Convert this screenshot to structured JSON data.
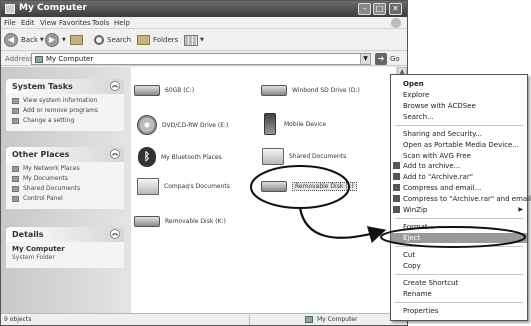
{
  "window": {
    "title": "My Computer"
  },
  "menu": [
    "File",
    "Edit",
    "View",
    "Favorites",
    "Tools",
    "Help"
  ],
  "toolbar": {
    "back": "Back",
    "search": "Search",
    "folders": "Folders"
  },
  "address": {
    "label": "Address",
    "value": "My Computer",
    "go": "Go"
  },
  "tasks": {
    "system": {
      "title": "System Tasks",
      "items": [
        "View system information",
        "Add or remove programs",
        "Change a setting"
      ]
    },
    "places": {
      "title": "Other Places",
      "items": [
        "My Network Places",
        "My Documents",
        "Shared Documents",
        "Control Panel"
      ]
    },
    "details": {
      "title": "Details",
      "name": "My Computer",
      "desc": "System Folder"
    }
  },
  "items": [
    {
      "label": "60GB (C:)",
      "icon": "hard-drive-icon"
    },
    {
      "label": "Winbond SD Drive (D:)",
      "icon": "hard-drive-icon"
    },
    {
      "label": "DVD/CD-RW Drive (E:)",
      "icon": "cd-drive-icon"
    },
    {
      "label": "Mobile Device",
      "icon": "mobile-device-icon"
    },
    {
      "label": "My Bluetooth Places",
      "icon": "bluetooth-icon"
    },
    {
      "label": "Shared Documents",
      "icon": "folder-icon"
    },
    {
      "label": "Compaq's Documents",
      "icon": "folder-icon"
    },
    {
      "label": "Removable Disk (J:)",
      "icon": "removable-disk-icon"
    },
    {
      "label": "Removable Disk (K:)",
      "icon": "removable-disk-icon"
    }
  ],
  "status": {
    "objects": "9 objects",
    "location": "My Computer"
  },
  "context_menu": {
    "items": [
      "Open",
      "Explore",
      "Browse with ACDSee",
      "Search...",
      "Sharing and Security...",
      "Open as Portable Media Device...",
      "Scan with AVG Free",
      "Add to archive...",
      "Add to \"Archive.rar\"",
      "Compress and email...",
      "Compress to \"Archive.rar\" and email",
      "WinZip",
      "Format...",
      "Eject",
      "Cut",
      "Copy",
      "Create Shortcut",
      "Rename",
      "Properties"
    ],
    "highlighted": "Eject"
  },
  "colors": {
    "titlebar": "#3c3c3c",
    "highlight": "#9a9a9a"
  }
}
